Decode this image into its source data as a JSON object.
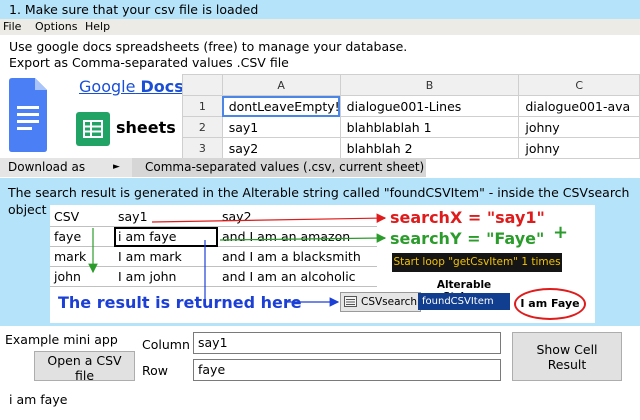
{
  "step_banner": "1. Make sure that your csv file is loaded",
  "menu": [
    "File",
    "Options",
    "Help"
  ],
  "instructions": [
    "Use google docs spreadsheets (free) to manage your database.",
    "Export as Comma-separated values .CSV file"
  ],
  "google_docs": {
    "google": "Google",
    "docs": "Docs"
  },
  "sheets_label": "sheets",
  "spreadsheet": {
    "columns": [
      "A",
      "B",
      "C"
    ],
    "rows": [
      {
        "num": "1",
        "cells": [
          "dontLeaveEmpty!",
          "dialogue001-Lines",
          "dialogue001-ava"
        ]
      },
      {
        "num": "2",
        "cells": [
          "say1",
          "blahblablah 1",
          "johny"
        ]
      },
      {
        "num": "3",
        "cells": [
          "say2",
          "blahblah 2",
          "johny"
        ]
      }
    ]
  },
  "download": {
    "label": "Download as",
    "arrow": "►",
    "option": "Comma-separated values (.csv, current sheet)"
  },
  "explanation": "The search result is generated in the Alterable string called \"foundCSVItem\" - inside the CSVsearch object",
  "csv_table": [
    [
      "CSV",
      "say1",
      "say2"
    ],
    [
      "faye",
      "i am faye",
      "and I am an amazon"
    ],
    [
      "mark",
      "I am mark",
      "and I am a blacksmith"
    ],
    [
      "john",
      "I am john",
      "and I am an alcoholic"
    ]
  ],
  "search_x": "searchX = \"say1\"",
  "search_y": "searchY = \"Faye\"",
  "plus": "+",
  "loop_label": "Start loop \"getCsvItem\" 1 times",
  "result_label": "The result is returned here",
  "csvsearch_label": "CSVsearch",
  "alterable": {
    "title": "Alterable Strings",
    "item": "foundCSVItem"
  },
  "result_value": "I am Faye",
  "app": {
    "title": "Example mini app",
    "open_button": "Open a CSV file",
    "column_label": "Column",
    "column_value": "say1",
    "row_label": "Row",
    "row_value": "faye",
    "show_button": "Show Cell Result",
    "output": "i am faye"
  },
  "colors": {
    "banner": "#b5e3fa",
    "red": "#e01b1b",
    "green": "#2b9c2b",
    "blue": "#1c3fd6"
  }
}
